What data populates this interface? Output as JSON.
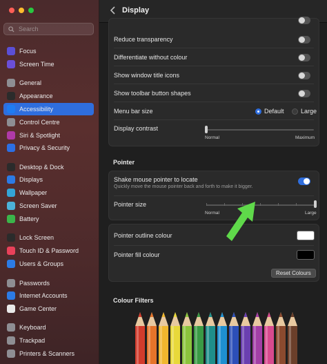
{
  "sidebar": {
    "search_placeholder": "Search",
    "items": [
      {
        "label": "Focus",
        "icon": "moon-icon",
        "color": "#5b4fd6"
      },
      {
        "label": "Screen Time",
        "icon": "hourglass-icon",
        "color": "#6b4fd8"
      },
      {
        "label": "General",
        "icon": "gear-icon",
        "color": "#8e8e93"
      },
      {
        "label": "Appearance",
        "icon": "appearance-icon",
        "color": "#2b2b2b"
      },
      {
        "label": "Accessibility",
        "icon": "accessibility-icon",
        "color": "#1f7cf2"
      },
      {
        "label": "Control Centre",
        "icon": "control-centre-icon",
        "color": "#8e8e93"
      },
      {
        "label": "Siri & Spotlight",
        "icon": "siri-icon",
        "color": "#b03aa8"
      },
      {
        "label": "Privacy & Security",
        "icon": "hand-icon",
        "color": "#2c6fe3"
      },
      {
        "label": "Desktop & Dock",
        "icon": "dock-icon",
        "color": "#2b2b2b"
      },
      {
        "label": "Displays",
        "icon": "display-icon",
        "color": "#2c7be5"
      },
      {
        "label": "Wallpaper",
        "icon": "wallpaper-icon",
        "color": "#34a4d6"
      },
      {
        "label": "Screen Saver",
        "icon": "screen-saver-icon",
        "color": "#4cb2d8"
      },
      {
        "label": "Battery",
        "icon": "battery-icon",
        "color": "#3bb54a"
      },
      {
        "label": "Lock Screen",
        "icon": "lock-icon",
        "color": "#2b2b2b"
      },
      {
        "label": "Touch ID & Password",
        "icon": "fingerprint-icon",
        "color": "#e9415a"
      },
      {
        "label": "Users & Groups",
        "icon": "users-icon",
        "color": "#2c7be5"
      },
      {
        "label": "Passwords",
        "icon": "key-icon",
        "color": "#8e8e93"
      },
      {
        "label": "Internet Accounts",
        "icon": "at-icon",
        "color": "#2c7be5"
      },
      {
        "label": "Game Center",
        "icon": "game-center-icon",
        "color": "#e9e9e9"
      },
      {
        "label": "Keyboard",
        "icon": "keyboard-icon",
        "color": "#8e8e93"
      },
      {
        "label": "Trackpad",
        "icon": "trackpad-icon",
        "color": "#8e8e93"
      },
      {
        "label": "Printers & Scanners",
        "icon": "printer-icon",
        "color": "#8e8e93"
      }
    ]
  },
  "header": {
    "title": "Display"
  },
  "display_group": {
    "reduce_transparency": "Reduce transparency",
    "differentiate": "Differentiate without colour",
    "window_title_icons": "Show window title icons",
    "toolbar_shapes": "Show toolbar button shapes",
    "menu_bar_size": "Menu bar size",
    "menu_bar_default": "Default",
    "menu_bar_large": "Large",
    "display_contrast": "Display contrast",
    "contrast_min": "Normal",
    "contrast_max": "Maximum",
    "contrast_level": 0
  },
  "pointer": {
    "heading": "Pointer",
    "shake_label": "Shake mouse pointer to locate",
    "shake_desc": "Quickly move the mouse pointer back and forth to make it bigger.",
    "shake_on": true,
    "size_label": "Pointer size",
    "size_min": "Normal",
    "size_max": "Large",
    "size_level": 1.0,
    "outline_label": "Pointer outline colour",
    "outline_color": "#ffffff",
    "fill_label": "Pointer fill colour",
    "fill_color": "#000000",
    "reset_label": "Reset Colours"
  },
  "colour_filters": {
    "heading": "Colour Filters"
  },
  "annotation": {
    "arrow_color": "#5fd94a"
  },
  "pencils": [
    "#d23b2c",
    "#e5742a",
    "#f0b72e",
    "#e8d83a",
    "#8bc43c",
    "#3a9a45",
    "#1f8e8a",
    "#1e8fd0",
    "#2c4fb8",
    "#6a3fb0",
    "#a33fa6",
    "#d74a8f",
    "#8b4a2e",
    "#6b3f2a"
  ]
}
